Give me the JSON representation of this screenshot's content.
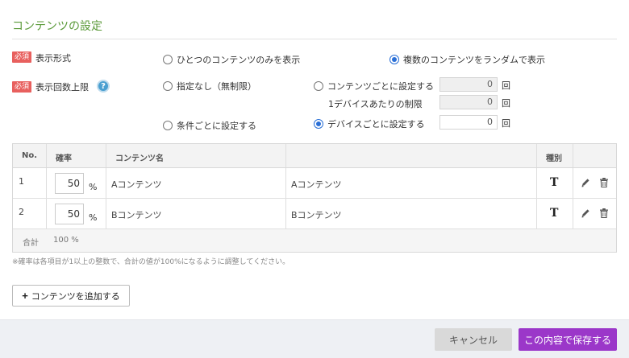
{
  "section": {
    "title": "コンテンツの設定"
  },
  "display_format": {
    "badge": "必須",
    "label": "表示形式",
    "option_single": "ひとつのコンテンツのみを表示",
    "option_random": "複数のコンテンツをランダムで表示",
    "selected": "random"
  },
  "display_limit": {
    "badge": "必須",
    "label": "表示回数上限",
    "help": "?",
    "option_none": "指定なし（無制限）",
    "option_per_content": "コンテンツごとに設定する",
    "per_content_value": "0",
    "per_device_limit_label": "1デバイスあたりの制限",
    "per_device_limit_value": "0",
    "option_per_condition": "条件ごとに設定する",
    "option_per_device": "デバイスごとに設定する",
    "per_device_value": "0",
    "unit": "回",
    "selected": "per_device"
  },
  "table": {
    "headers": {
      "no": "No.",
      "prob": "確率",
      "name": "コンテンツ名",
      "desc": "",
      "type": "種別",
      "actions": ""
    },
    "rows": [
      {
        "no": "1",
        "prob": "50",
        "unit": "%",
        "name": "Aコンテンツ",
        "desc": "Aコンテンツ"
      },
      {
        "no": "2",
        "prob": "50",
        "unit": "%",
        "name": "Bコンテンツ",
        "desc": "Bコンテンツ"
      }
    ],
    "type_icon_text": "T",
    "sum_label": "合計",
    "sum_value": "100 %"
  },
  "note": "※確率は各項目が1以上の整数で、合計の値が100%になるように調整してください。",
  "add_button": {
    "plus": "+",
    "label": "コンテンツを追加する"
  },
  "footer": {
    "cancel_label": "キャンセル",
    "save_label": "この内容で保存する"
  },
  "colors": {
    "title": "#5b9a3a",
    "badge": "#e8605e",
    "radio": "#2a6fd6",
    "save": "#9b37c9",
    "help": "#4a9fd0"
  }
}
